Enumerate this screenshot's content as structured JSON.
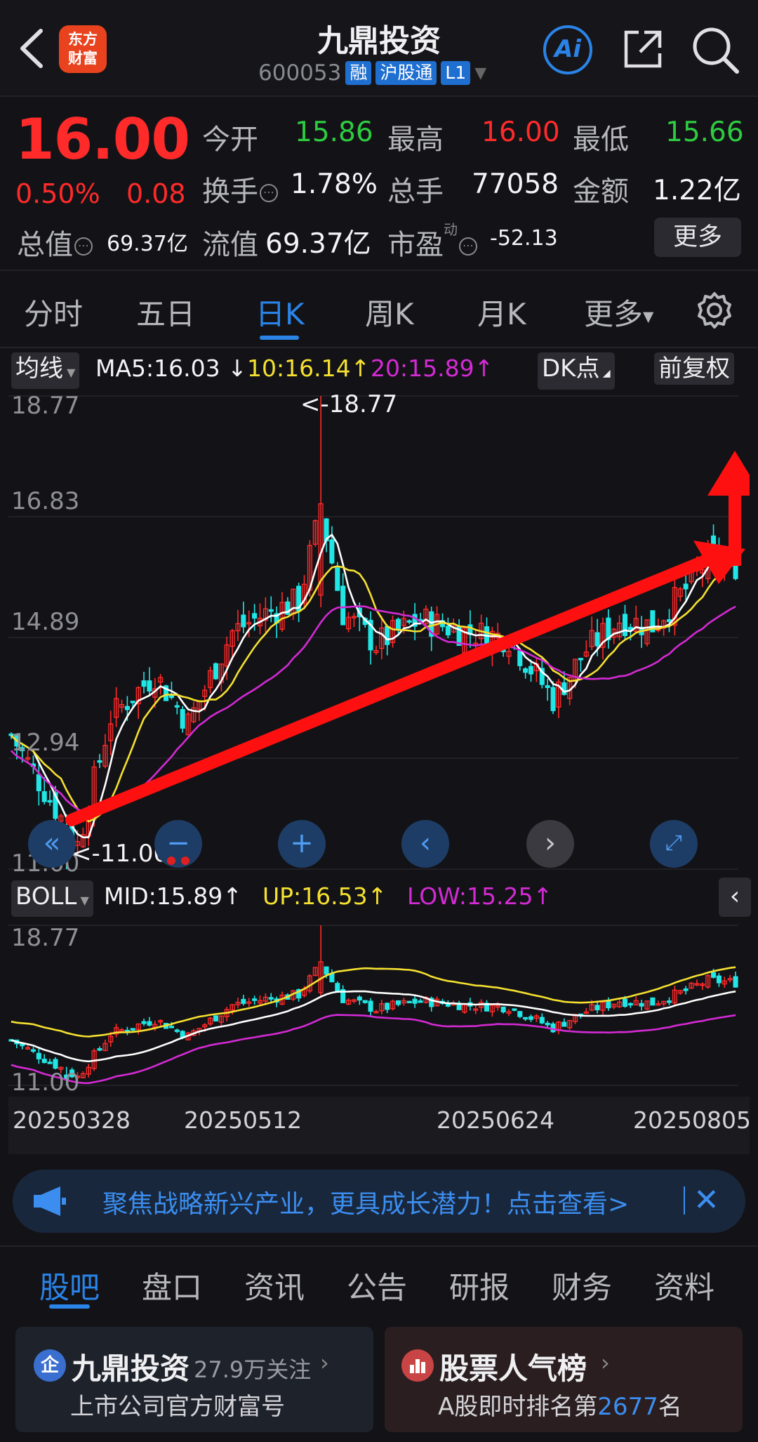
{
  "header": {
    "stock_name": "九鼎投资",
    "stock_code": "600053",
    "tags": [
      "融",
      "沪股通",
      "L1"
    ],
    "logo_text": "东方\n财富",
    "ai_label": "Ai"
  },
  "quote": {
    "price": "16.00",
    "change_pct": "0.50%",
    "change": "0.08",
    "open_label": "今开",
    "open": "15.86",
    "high_label": "最高",
    "high": "16.00",
    "low_label": "最低",
    "low": "15.66",
    "turnover_label": "换手",
    "turnover": "1.78%",
    "volume_label": "总手",
    "volume": "77058",
    "amount_label": "金额",
    "amount": "1.22亿",
    "mktcap_label": "总值",
    "mktcap": "69.37亿",
    "float_label": "流值",
    "float_cap": "69.37亿",
    "pe_label": "市盈",
    "pe_sup": "动",
    "pe": "-52.13",
    "more_label": "更多"
  },
  "tabs": [
    "分时",
    "五日",
    "日K",
    "周K",
    "月K",
    "更多"
  ],
  "active_tab": "日K",
  "ma_bar": {
    "selector": "均线",
    "ma5": "MA5:16.03",
    "ma10": "10:16.14",
    "ma20": "20:15.89",
    "dk": "DK点",
    "adjust": "前复权"
  },
  "boll_bar": {
    "selector": "BOLL",
    "mid": "MID:15.89",
    "up": "UP:16.53",
    "low": "LOW:15.25"
  },
  "chart_data": [
    {
      "type": "candlestick",
      "title": "",
      "y_ticks": [
        "18.77",
        "16.83",
        "14.89",
        "12.94",
        "11.00"
      ],
      "ylim": [
        11.0,
        18.77
      ],
      "annotations": [
        "<-18.77",
        "<-11.00"
      ],
      "series": [
        {
          "name": "MA5",
          "color": "#ffffff"
        },
        {
          "name": "MA10",
          "color": "#f5e030"
        },
        {
          "name": "MA20",
          "color": "#d42ad4"
        }
      ],
      "trend_arrow_color": "#ff1010"
    },
    {
      "type": "candlestick",
      "title": "",
      "y_ticks": [
        "18.77",
        "11.00"
      ],
      "ylim": [
        11.0,
        18.77
      ],
      "x_ticks": [
        "20250328",
        "20250512",
        "20250624",
        "20250805"
      ],
      "series": [
        {
          "name": "MID",
          "color": "#ffffff"
        },
        {
          "name": "UP",
          "color": "#f5e030"
        },
        {
          "name": "LOW",
          "color": "#d42ad4"
        }
      ]
    }
  ],
  "banner": {
    "text": "聚焦战略新兴产业，更具成长潜力！点击查看>"
  },
  "bottom_tabs": [
    "股吧",
    "盘口",
    "资讯",
    "公告",
    "研报",
    "财务",
    "资料"
  ],
  "cards": {
    "left_title": "九鼎投资",
    "left_count": "27.9万关注",
    "left_sub": "上市公司官方财富号",
    "right_title": "股票人气榜",
    "right_sub_prefix": "A股即时排名第",
    "right_rank": "2677",
    "right_sub_suffix": "名"
  },
  "colors": {
    "up": "#ff2a2a",
    "down": "#2ecc40",
    "candle_down": "#21e6e6",
    "accent": "#2a84e8"
  }
}
